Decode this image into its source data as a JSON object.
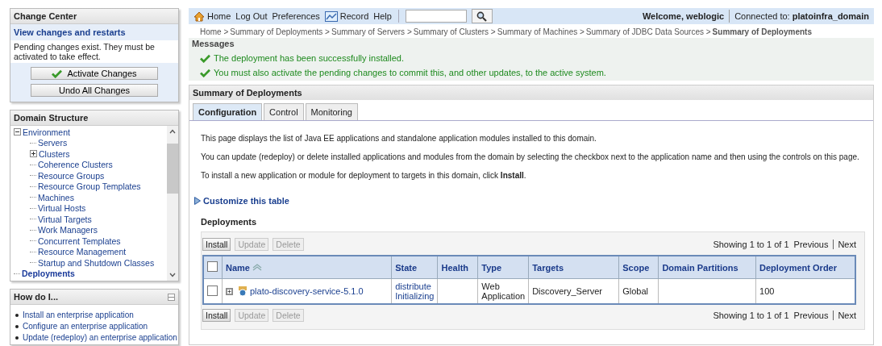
{
  "change_center": {
    "title": "Change Center",
    "link": "View changes and restarts",
    "message": "Pending changes exist. They must be activated to take effect.",
    "buttons": [
      {
        "label": "Activate Changes",
        "kind": "activate"
      },
      {
        "label": "Undo All Changes",
        "kind": "plain"
      }
    ]
  },
  "domain_structure": {
    "title": "Domain Structure",
    "tree": [
      {
        "label": "Environment",
        "selected": false,
        "expanded": true,
        "children": [
          {
            "label": "Servers",
            "selected": false
          },
          {
            "label": "Clusters",
            "selected": false,
            "expanded": false
          },
          {
            "label": "Coherence Clusters",
            "selected": false
          },
          {
            "label": "Resource Groups",
            "selected": false
          },
          {
            "label": "Resource Group Templates",
            "selected": false
          },
          {
            "label": "Machines",
            "selected": false
          },
          {
            "label": "Virtual Hosts",
            "selected": false
          },
          {
            "label": "Virtual Targets",
            "selected": false
          },
          {
            "label": "Work Managers",
            "selected": false
          },
          {
            "label": "Concurrent Templates",
            "selected": false
          },
          {
            "label": "Resource Management",
            "selected": false
          },
          {
            "label": "Startup and Shutdown Classes",
            "selected": false
          }
        ]
      },
      {
        "label": "Deployments",
        "selected": true
      }
    ]
  },
  "how_do_i": {
    "title": "How do I...",
    "links": [
      "Install an enterprise application",
      "Configure an enterprise application",
      "Update (redeploy) an enterprise application"
    ]
  },
  "toolbar": {
    "items": [
      {
        "label": "Home",
        "kind": "home"
      },
      {
        "label": "Log Out",
        "kind": "text"
      },
      {
        "label": "Preferences",
        "kind": "text"
      },
      {
        "label": "Record",
        "kind": "record"
      },
      {
        "label": "Help",
        "kind": "text"
      }
    ],
    "welcome": "Welcome, weblogic",
    "connected_label": "Connected to:",
    "domain": "platoinfra_domain"
  },
  "breadcrumb": [
    {
      "label": "Home >",
      "current": false
    },
    {
      "label": "Summary of Deployments >",
      "current": false
    },
    {
      "label": "Summary of Servers >",
      "current": false
    },
    {
      "label": "Summary of Clusters >",
      "current": false
    },
    {
      "label": "Summary of Machines >",
      "current": false
    },
    {
      "label": "Summary of JDBC Data Sources >",
      "current": false
    },
    {
      "label": "Summary of Deployments",
      "current": true
    }
  ],
  "messages": {
    "title": "Messages",
    "items": [
      "The deployment has been successfully installed.",
      "You must also activate the pending changes to commit this, and other updates, to the active system."
    ]
  },
  "summary": {
    "title": "Summary of Deployments",
    "tabs": [
      {
        "label": "Configuration",
        "selected": true
      },
      {
        "label": "Control",
        "selected": false
      },
      {
        "label": "Monitoring",
        "selected": false
      }
    ],
    "paragraphs": [
      "This page displays the list of Java EE applications and standalone application modules installed to this domain.",
      "You can update (redeploy) or delete installed applications and modules from the domain by selecting the checkbox next to the application name and then using the controls on this page.",
      "To install a new application or module for deployment to targets in this domain, click **Install**."
    ],
    "customize": "Customize this table",
    "deployments": {
      "title": "Deployments",
      "top_buttons": [
        {
          "label": "Install",
          "disabled": false
        },
        {
          "label": "Update",
          "disabled": true
        },
        {
          "label": "Delete",
          "disabled": true
        }
      ],
      "top_pager": {
        "showing": "Showing 1 to 1 of 1",
        "previous": "Previous",
        "next": "Next"
      },
      "columns": [
        "Name",
        "State",
        "Health",
        "Type",
        "Targets",
        "Scope",
        "Domain Partitions",
        "Deployment Order"
      ],
      "header_checked": false,
      "rows": [
        {
          "checked": false,
          "expanded": false,
          "name": "plato-discovery-service-5.1.0",
          "state": "distribute Initializing",
          "health": "",
          "type": "Web Application",
          "targets": "Discovery_Server",
          "scope": "Global",
          "partitions": "",
          "order": "100"
        }
      ],
      "bottom_buttons": [
        {
          "label": "Install",
          "disabled": false
        },
        {
          "label": "Update",
          "disabled": true
        },
        {
          "label": "Delete",
          "disabled": true
        }
      ],
      "bottom_pager": {
        "showing": "Showing 1 to 1 of 1",
        "previous": "Previous",
        "next": "Next"
      }
    }
  }
}
